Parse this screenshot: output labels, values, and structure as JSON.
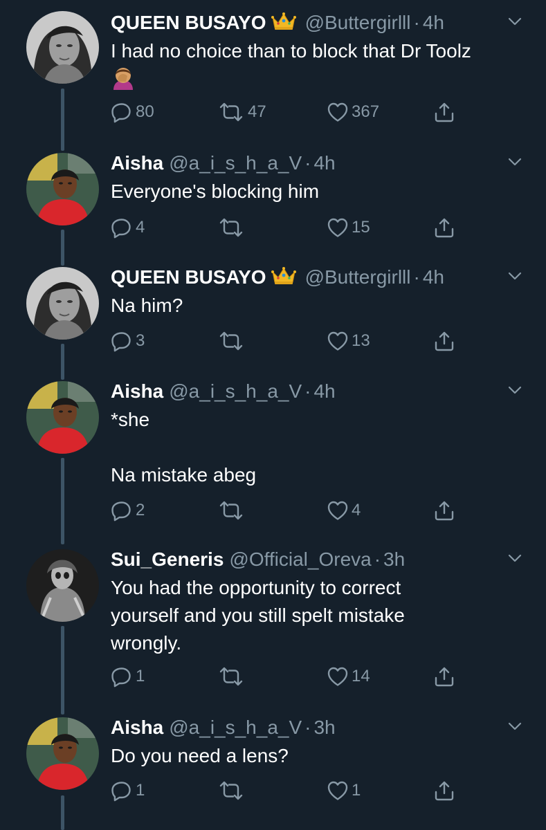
{
  "colors": {
    "background": "#15202b",
    "secondary_text": "#8899a6",
    "thread_line": "#3d5466"
  },
  "tweets": [
    {
      "name": "QUEEN BUSAYO",
      "crown": true,
      "handle": "@Buttergirlll",
      "sep": "·",
      "time": "4h",
      "lines": [
        "I had no choice than to block that Dr Toolz"
      ],
      "emoji": "woman-facepalming",
      "replies": "80",
      "retweets": "47",
      "likes": "367"
    },
    {
      "name": "Aisha",
      "crown": false,
      "handle": "@a_i_s_h_a_V",
      "sep": "·",
      "time": "4h",
      "lines": [
        "Everyone's blocking him"
      ],
      "replies": "4",
      "retweets": "",
      "likes": "15"
    },
    {
      "name": "QUEEN BUSAYO",
      "crown": true,
      "handle": "@Buttergirlll",
      "sep": "·",
      "time": "4h",
      "lines": [
        "Na him?"
      ],
      "replies": "3",
      "retweets": "",
      "likes": "13"
    },
    {
      "name": "Aisha",
      "crown": false,
      "handle": "@a_i_s_h_a_V",
      "sep": "·",
      "time": "4h",
      "lines": [
        "*she",
        "Na mistake abeg"
      ],
      "replies": "2",
      "retweets": "",
      "likes": "4"
    },
    {
      "name": "Sui_Generis",
      "crown": false,
      "handle": "@Official_Oreva",
      "sep": "·",
      "time": "3h",
      "lines": [
        "You had the opportunity to correct",
        "yourself and you still spelt mistake",
        "wrongly."
      ],
      "replies": "1",
      "retweets": "",
      "likes": "14"
    },
    {
      "name": "Aisha",
      "crown": false,
      "handle": "@a_i_s_h_a_V",
      "sep": "·",
      "time": "3h",
      "lines": [
        "Do you need a lens?"
      ],
      "replies": "1",
      "retweets": "",
      "likes": "1"
    }
  ]
}
